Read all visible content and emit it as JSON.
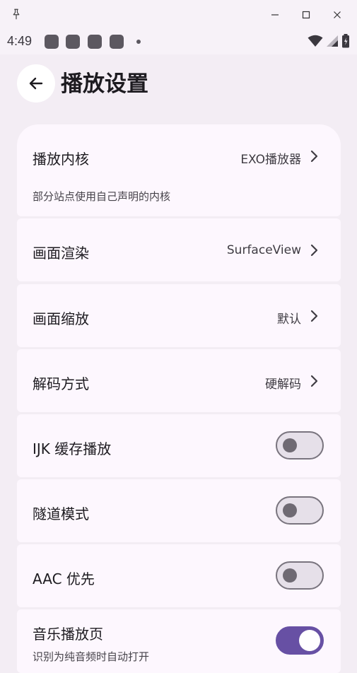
{
  "status_bar": {
    "time": "4:49"
  },
  "header": {
    "title": "播放设置"
  },
  "settings": {
    "player_core": {
      "label": "播放内核",
      "value": "EXO播放器",
      "subtitle": "部分站点使用自己声明的内核"
    },
    "render": {
      "label": "画面渲染",
      "value": "SurfaceView"
    },
    "scale": {
      "label": "画面缩放",
      "value": "默认"
    },
    "decode": {
      "label": "解码方式",
      "value": "硬解码"
    },
    "ijk_cache": {
      "label": "IJK 缓存播放",
      "enabled": false
    },
    "tunnel": {
      "label": "隧道模式",
      "enabled": false
    },
    "aac": {
      "label": "AAC 优先",
      "enabled": false
    },
    "music_page": {
      "label": "音乐播放页",
      "subtitle": "识别为纯音频时自动打开",
      "enabled": true
    }
  },
  "colors": {
    "background": "#f3edf4",
    "card": "#fdf7fe",
    "accent": "#6750a4",
    "toggle_off_track": "#e6e0e9",
    "toggle_outline": "#79747e"
  },
  "icons": {
    "window_pin": "pin-icon",
    "window_minimize": "minimize-icon",
    "window_maximize": "maximize-icon",
    "window_close": "close-icon",
    "back": "arrow-left-icon",
    "chevron": "chevron-right-icon",
    "wifi": "wifi-icon",
    "signal": "signal-icon",
    "battery": "battery-icon"
  }
}
